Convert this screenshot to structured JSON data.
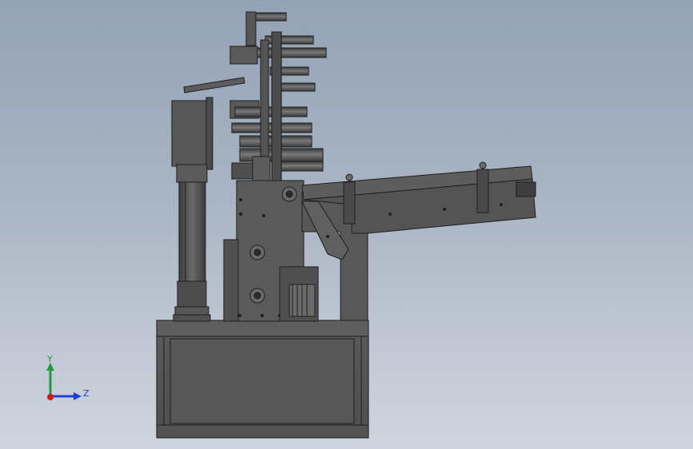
{
  "viewport": {
    "model_view": "machine-side-view"
  },
  "triad": {
    "y_label": "Y",
    "z_label": "Z",
    "colors": {
      "y_axis": "#1f9a3a",
      "z_axis": "#1f3fd0",
      "origin": "#d01818"
    }
  },
  "colors": {
    "body_dark": "#4a4a4a",
    "body_mid": "#5c5c5c",
    "body_light": "#6e6e6e",
    "edge": "#1e1e1e"
  }
}
